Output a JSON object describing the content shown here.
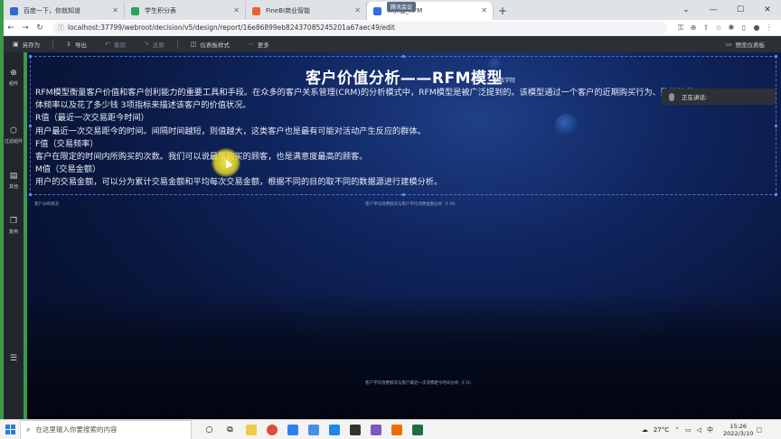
{
  "browser": {
    "tabs": [
      {
        "label": "百度一下，你就知道",
        "favicon_color": "#3367d6",
        "active": false
      },
      {
        "label": "学生积分表",
        "favicon_color": "#23a459",
        "active": false
      },
      {
        "label": "FineBI商业智能",
        "favicon_color": "#e8642c",
        "active": false
      },
      {
        "label": "...价值_RFM",
        "favicon_color": "#2f6de1",
        "active": true
      }
    ],
    "new_tab": "+",
    "recording_badge": "腾讯会议",
    "url": "localhost:37799/webroot/decision/v5/design/report/16e86899eb82437085245201a67aec49/edit"
  },
  "toolbar": {
    "save_as": "另存为",
    "export": "导出",
    "undo": "撤销",
    "redo": "还原",
    "dashboard_style": "仪表板样式",
    "more": "更多",
    "preview": "预览仪表板"
  },
  "sidebar": {
    "items": [
      {
        "label": "组件",
        "icon": "plus-icon"
      },
      {
        "label": "过滤组件",
        "icon": "filter-icon"
      },
      {
        "label": "其他",
        "icon": "doc-icon"
      },
      {
        "label": "复用",
        "icon": "copy-icon"
      }
    ]
  },
  "report": {
    "title": "客户价值分析——RFM模型",
    "title_sub": "聚数学院",
    "lines": [
      "RFM模型衡量客户价值和客户创利能力的重要工具和手段。在众多的客户关系管理(CRM)的分析模式中，RFM模型是被广泛提到的。该模型通过一个客户的近期购买行为、购买的总",
      "体频率以及花了多少钱 3项指标来描述该客户的价值状况。",
      "R值（最近一次交易距今时间）",
      "用户最近一次交易距今的时间。间隔时间越短，则值越大，这类客户也是最有可能对活动产生反应的群体。",
      "F值（交易频率）",
      "客户在限定的时间内所购买的次数。我们可以说最常购买的顾客，也是满意度最高的顾客。",
      "M值（交易金额）",
      "用户的交易金额，可以分为累计交易金额和平均每次交易金额，根据不同的目的取不同的数据源进行建模分析。"
    ],
    "mini_labels": [
      "客户分布情况",
      "客户平均消费频次与客户平均消费金额分析（F,M）",
      "客户平均消费频次与客户最近一次消费距今时间分析（F,R）"
    ]
  },
  "speaker_popup": "正在讲话:",
  "taskbar": {
    "search_placeholder": "在这里输入你要搜索的内容",
    "weather": "27°C",
    "ime": "中",
    "time": "15:26",
    "date": "2022/3/10"
  }
}
